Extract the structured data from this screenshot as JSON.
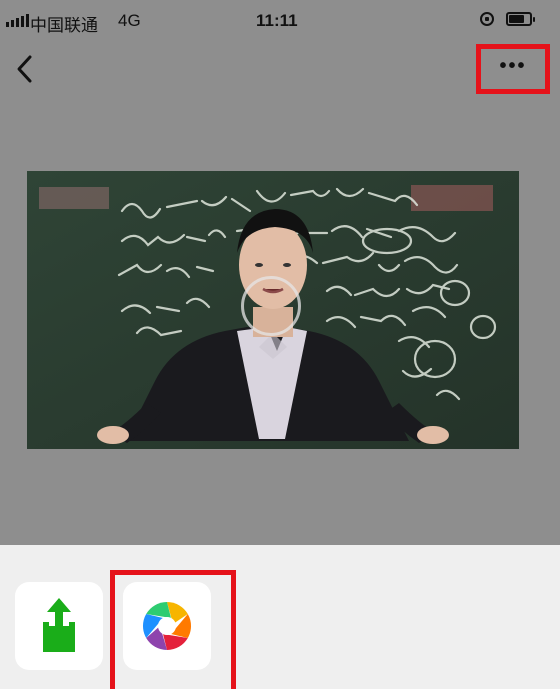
{
  "status_bar": {
    "carrier": "中国联通",
    "network": "4G",
    "time": "11:11",
    "battery_level": 0.75
  },
  "nav": {
    "back_icon": "chevron-left-icon",
    "more_label": "•••"
  },
  "video": {
    "play_icon": "play-ring-icon"
  },
  "share_sheet": {
    "items": [
      {
        "icon": "send-to-friend-icon",
        "accent": "#1aad19"
      },
      {
        "icon": "moments-aperture-icon",
        "accent": "#f5a623"
      }
    ]
  },
  "colors": {
    "overlay": "#8e8e8e",
    "highlight": "#e5121a",
    "share_green": "#1aad19"
  }
}
